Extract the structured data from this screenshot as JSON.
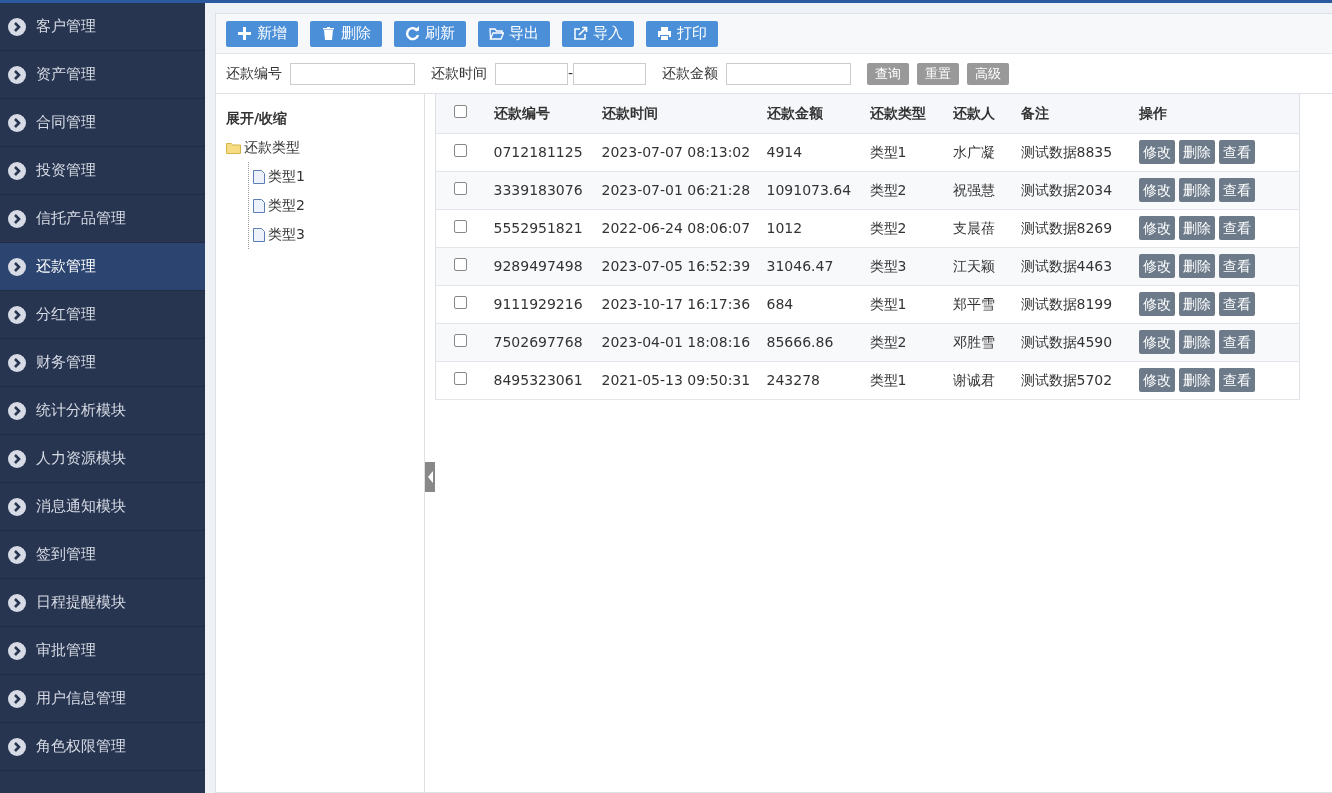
{
  "sidebar": {
    "items": [
      {
        "label": "客户管理",
        "selected": false
      },
      {
        "label": "资产管理",
        "selected": false
      },
      {
        "label": "合同管理",
        "selected": false
      },
      {
        "label": "投资管理",
        "selected": false
      },
      {
        "label": "信托产品管理",
        "selected": false
      },
      {
        "label": "还款管理",
        "selected": true
      },
      {
        "label": "分红管理",
        "selected": false
      },
      {
        "label": "财务管理",
        "selected": false
      },
      {
        "label": "统计分析模块",
        "selected": false
      },
      {
        "label": "人力资源模块",
        "selected": false
      },
      {
        "label": "消息通知模块",
        "selected": false
      },
      {
        "label": "签到管理",
        "selected": false
      },
      {
        "label": "日程提醒模块",
        "selected": false
      },
      {
        "label": "审批管理",
        "selected": false
      },
      {
        "label": "用户信息管理",
        "selected": false
      },
      {
        "label": "角色权限管理",
        "selected": false
      }
    ]
  },
  "toolbar": [
    {
      "label": "新增",
      "kind": "plus"
    },
    {
      "label": "删除",
      "kind": "trash"
    },
    {
      "label": "刷新",
      "kind": "refresh"
    },
    {
      "label": "导出",
      "kind": "folder"
    },
    {
      "label": "导入",
      "kind": "external"
    },
    {
      "label": "打印",
      "kind": "print"
    }
  ],
  "search": {
    "fields": [
      {
        "label": "还款编号",
        "kind": "text"
      },
      {
        "label": "还款时间",
        "kind": "range",
        "separator": "-"
      },
      {
        "label": "还款金额",
        "kind": "text"
      }
    ],
    "buttons": [
      "查询",
      "重置",
      "高级"
    ]
  },
  "tree": {
    "root": "展开/收缩",
    "children": [
      {
        "label": "还款类型",
        "children": [
          {
            "label": "类型1"
          },
          {
            "label": "类型2"
          },
          {
            "label": "类型3"
          }
        ]
      }
    ]
  },
  "table": {
    "columns": [
      "还款编号",
      "还款时间",
      "还款金额",
      "还款类型",
      "还款人",
      "备注",
      "操作"
    ],
    "header_checked": false,
    "rows": [
      {
        "checked": false,
        "cells": [
          "0712181125",
          "2023-07-07 08:13:02",
          "4914",
          "类型1",
          "水广凝",
          "测试数据8835"
        ],
        "actions": [
          "修改",
          "删除",
          "查看"
        ]
      },
      {
        "checked": false,
        "cells": [
          "3339183076",
          "2023-07-01 06:21:28",
          "1091073.64",
          "类型2",
          "祝强慧",
          "测试数据2034"
        ],
        "actions": [
          "修改",
          "删除",
          "查看"
        ]
      },
      {
        "checked": false,
        "cells": [
          "5552951821",
          "2022-06-24 08:06:07",
          "1012",
          "类型2",
          "支晨蓓",
          "测试数据8269"
        ],
        "actions": [
          "修改",
          "删除",
          "查看"
        ]
      },
      {
        "checked": false,
        "cells": [
          "9289497498",
          "2023-07-05 16:52:39",
          "31046.47",
          "类型3",
          "江天颖",
          "测试数据4463"
        ],
        "actions": [
          "修改",
          "删除",
          "查看"
        ]
      },
      {
        "checked": false,
        "cells": [
          "9111929216",
          "2023-10-17 16:17:36",
          "684",
          "类型1",
          "郑平雪",
          "测试数据8199"
        ],
        "actions": [
          "修改",
          "删除",
          "查看"
        ]
      },
      {
        "checked": false,
        "cells": [
          "7502697768",
          "2023-04-01 18:08:16",
          "85666.86",
          "类型2",
          "邓胜雪",
          "测试数据4590"
        ],
        "actions": [
          "修改",
          "删除",
          "查看"
        ]
      },
      {
        "checked": false,
        "cells": [
          "8495323061",
          "2021-05-13 09:50:31",
          "243278",
          "类型1",
          "谢诚君",
          "测试数据5702"
        ],
        "actions": [
          "修改",
          "删除",
          "查看"
        ]
      }
    ]
  }
}
